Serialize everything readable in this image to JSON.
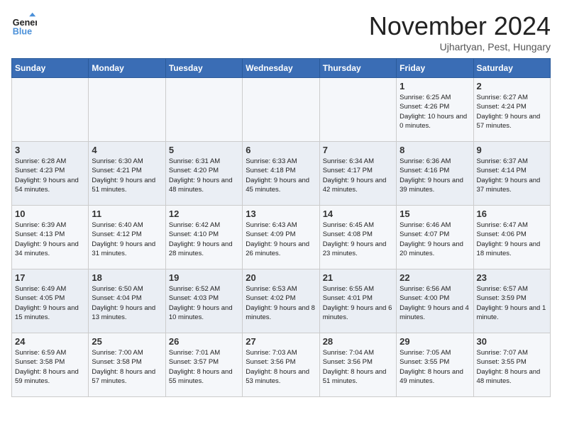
{
  "logo": {
    "line1": "General",
    "line2": "Blue"
  },
  "title": "November 2024",
  "location": "Ujhartyan, Pest, Hungary",
  "days_of_week": [
    "Sunday",
    "Monday",
    "Tuesday",
    "Wednesday",
    "Thursday",
    "Friday",
    "Saturday"
  ],
  "weeks": [
    [
      {
        "day": "",
        "text": ""
      },
      {
        "day": "",
        "text": ""
      },
      {
        "day": "",
        "text": ""
      },
      {
        "day": "",
        "text": ""
      },
      {
        "day": "",
        "text": ""
      },
      {
        "day": "1",
        "text": "Sunrise: 6:25 AM\nSunset: 4:26 PM\nDaylight: 10 hours and 0 minutes."
      },
      {
        "day": "2",
        "text": "Sunrise: 6:27 AM\nSunset: 4:24 PM\nDaylight: 9 hours and 57 minutes."
      }
    ],
    [
      {
        "day": "3",
        "text": "Sunrise: 6:28 AM\nSunset: 4:23 PM\nDaylight: 9 hours and 54 minutes."
      },
      {
        "day": "4",
        "text": "Sunrise: 6:30 AM\nSunset: 4:21 PM\nDaylight: 9 hours and 51 minutes."
      },
      {
        "day": "5",
        "text": "Sunrise: 6:31 AM\nSunset: 4:20 PM\nDaylight: 9 hours and 48 minutes."
      },
      {
        "day": "6",
        "text": "Sunrise: 6:33 AM\nSunset: 4:18 PM\nDaylight: 9 hours and 45 minutes."
      },
      {
        "day": "7",
        "text": "Sunrise: 6:34 AM\nSunset: 4:17 PM\nDaylight: 9 hours and 42 minutes."
      },
      {
        "day": "8",
        "text": "Sunrise: 6:36 AM\nSunset: 4:16 PM\nDaylight: 9 hours and 39 minutes."
      },
      {
        "day": "9",
        "text": "Sunrise: 6:37 AM\nSunset: 4:14 PM\nDaylight: 9 hours and 37 minutes."
      }
    ],
    [
      {
        "day": "10",
        "text": "Sunrise: 6:39 AM\nSunset: 4:13 PM\nDaylight: 9 hours and 34 minutes."
      },
      {
        "day": "11",
        "text": "Sunrise: 6:40 AM\nSunset: 4:12 PM\nDaylight: 9 hours and 31 minutes."
      },
      {
        "day": "12",
        "text": "Sunrise: 6:42 AM\nSunset: 4:10 PM\nDaylight: 9 hours and 28 minutes."
      },
      {
        "day": "13",
        "text": "Sunrise: 6:43 AM\nSunset: 4:09 PM\nDaylight: 9 hours and 26 minutes."
      },
      {
        "day": "14",
        "text": "Sunrise: 6:45 AM\nSunset: 4:08 PM\nDaylight: 9 hours and 23 minutes."
      },
      {
        "day": "15",
        "text": "Sunrise: 6:46 AM\nSunset: 4:07 PM\nDaylight: 9 hours and 20 minutes."
      },
      {
        "day": "16",
        "text": "Sunrise: 6:47 AM\nSunset: 4:06 PM\nDaylight: 9 hours and 18 minutes."
      }
    ],
    [
      {
        "day": "17",
        "text": "Sunrise: 6:49 AM\nSunset: 4:05 PM\nDaylight: 9 hours and 15 minutes."
      },
      {
        "day": "18",
        "text": "Sunrise: 6:50 AM\nSunset: 4:04 PM\nDaylight: 9 hours and 13 minutes."
      },
      {
        "day": "19",
        "text": "Sunrise: 6:52 AM\nSunset: 4:03 PM\nDaylight: 9 hours and 10 minutes."
      },
      {
        "day": "20",
        "text": "Sunrise: 6:53 AM\nSunset: 4:02 PM\nDaylight: 9 hours and 8 minutes."
      },
      {
        "day": "21",
        "text": "Sunrise: 6:55 AM\nSunset: 4:01 PM\nDaylight: 9 hours and 6 minutes."
      },
      {
        "day": "22",
        "text": "Sunrise: 6:56 AM\nSunset: 4:00 PM\nDaylight: 9 hours and 4 minutes."
      },
      {
        "day": "23",
        "text": "Sunrise: 6:57 AM\nSunset: 3:59 PM\nDaylight: 9 hours and 1 minute."
      }
    ],
    [
      {
        "day": "24",
        "text": "Sunrise: 6:59 AM\nSunset: 3:58 PM\nDaylight: 8 hours and 59 minutes."
      },
      {
        "day": "25",
        "text": "Sunrise: 7:00 AM\nSunset: 3:58 PM\nDaylight: 8 hours and 57 minutes."
      },
      {
        "day": "26",
        "text": "Sunrise: 7:01 AM\nSunset: 3:57 PM\nDaylight: 8 hours and 55 minutes."
      },
      {
        "day": "27",
        "text": "Sunrise: 7:03 AM\nSunset: 3:56 PM\nDaylight: 8 hours and 53 minutes."
      },
      {
        "day": "28",
        "text": "Sunrise: 7:04 AM\nSunset: 3:56 PM\nDaylight: 8 hours and 51 minutes."
      },
      {
        "day": "29",
        "text": "Sunrise: 7:05 AM\nSunset: 3:55 PM\nDaylight: 8 hours and 49 minutes."
      },
      {
        "day": "30",
        "text": "Sunrise: 7:07 AM\nSunset: 3:55 PM\nDaylight: 8 hours and 48 minutes."
      }
    ]
  ]
}
